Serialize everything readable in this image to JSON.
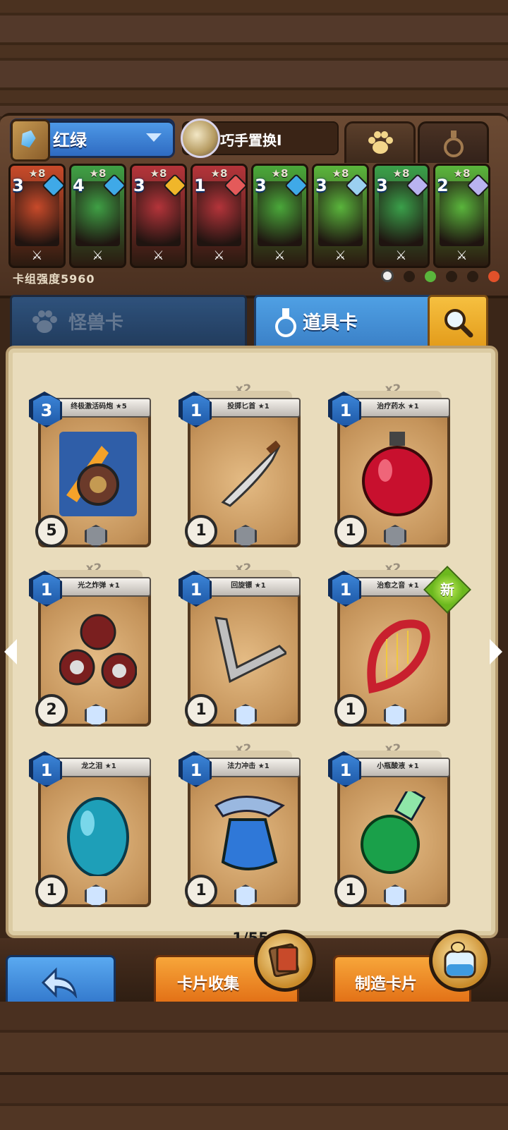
{
  "deck": {
    "name": "红绿",
    "skill": "巧手置换I",
    "power_label": "卡组强度5960",
    "slots": [
      {
        "cost": "3",
        "star": "★8",
        "bg": "#c84a2a",
        "badge": "#3fa9e8"
      },
      {
        "cost": "4",
        "star": "★8",
        "bg": "#3fa045",
        "badge": "#3fa9e8"
      },
      {
        "cost": "3",
        "star": "★8",
        "bg": "#b4343a",
        "badge": "#f0b62a"
      },
      {
        "cost": "1",
        "star": "★8",
        "bg": "#b4343a",
        "badge": "#e45a5a"
      },
      {
        "cost": "3",
        "star": "★8",
        "bg": "#4aa83a",
        "badge": "#3fa9e8"
      },
      {
        "cost": "3",
        "star": "★8",
        "bg": "#5ab53c",
        "badge": "#9bd0f0"
      },
      {
        "cost": "3",
        "star": "★8",
        "bg": "#3aa04a",
        "badge": "#b9b3f0"
      },
      {
        "cost": "2",
        "star": "★8",
        "bg": "#5ab53c",
        "badge": "#b9b3f0"
      }
    ]
  },
  "tabs": {
    "monster": "怪兽卡",
    "item": "道具卡"
  },
  "cards": [
    {
      "title": "终极激活码炮 ★5",
      "cost": "3",
      "x2": "",
      "stat": "5",
      "stat2": "3",
      "art": "cannon"
    },
    {
      "title": "投掷匕首 ★1",
      "cost": "1",
      "x2": "x2",
      "stat": "1",
      "art": "dagger"
    },
    {
      "title": "治疗药水 ★1",
      "cost": "1",
      "x2": "x2",
      "stat": "1",
      "art": "potion"
    },
    {
      "title": "光之炸弹 ★1",
      "cost": "1",
      "x2": "x2",
      "stat": "2",
      "art": "bombs"
    },
    {
      "title": "回旋镖 ★1",
      "cost": "1",
      "x2": "x2",
      "stat": "1",
      "art": "boomerang"
    },
    {
      "title": "治愈之音 ★1",
      "cost": "1",
      "x2": "x2",
      "stat": "1",
      "art": "harp"
    },
    {
      "title": "龙之泪 ★1",
      "cost": "1",
      "x2": "",
      "stat": "1",
      "art": "egg"
    },
    {
      "title": "法力冲击 ★1",
      "cost": "1",
      "x2": "x2",
      "stat": "1",
      "art": "mana"
    },
    {
      "title": "小瓶酸液 ★1",
      "cost": "1",
      "x2": "x2",
      "stat": "1",
      "art": "acid"
    }
  ],
  "new_badge": "新",
  "page": "1/55",
  "buttons": {
    "collect": "卡片收集",
    "craft": "制造卡片"
  }
}
